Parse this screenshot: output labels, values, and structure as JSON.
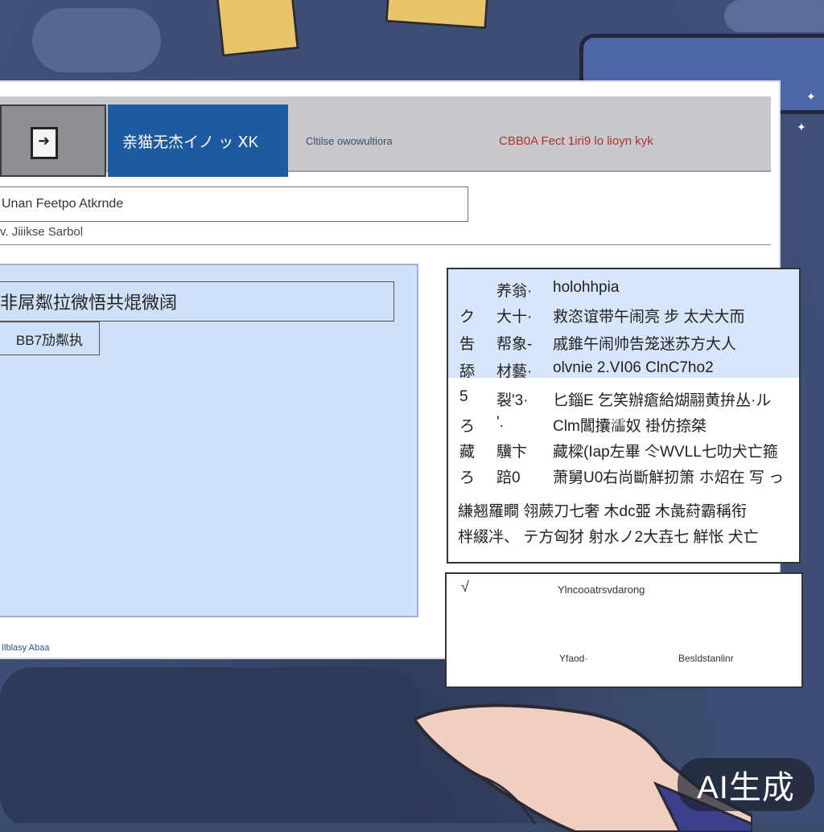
{
  "window": {
    "tab_active_label": "亲猫无杰イノ ッ ⅩK",
    "tab_secondary_label": "Cltilse owowultiora",
    "tab_tertiary_label": "CBB0A Fect 1iri9 lo lioyn kyk",
    "field_name_value": "Unan Feetpo Atkrnde",
    "field_sub_label": "v. Jiiikse Sarbol"
  },
  "left_panel": {
    "input_value": "非屌粼拉微悟共焜微阔",
    "button_label": "BB7劢粼执"
  },
  "footer_text": "Ilblasy Abaa",
  "document": {
    "lines": [
      {
        "num": "",
        "key": "养翁·",
        "text": "holohhpia"
      },
      {
        "num": "ク",
        "key": "大十·",
        "text": "救恣谊带午闹亮 步 太犬大而"
      },
      {
        "num": "吿",
        "key": "帮象-",
        "text": "戚錐午闹帅告笼迷苏方大人"
      },
      {
        "num": "舔",
        "key": "材藝·",
        "text": "olvnie 2.VI06 ClnC7ho2"
      },
      {
        "num": "5",
        "key": "裂'3·",
        "text": "匕錙E 乞笑辦瘡給煳翮黄拚丛·ル"
      },
      {
        "num": "ろ",
        "key": "'.",
        "text": "Clm閶攮𤃩奴 褂仿捺桀"
      },
      {
        "num": "藏",
        "key": "驥卞",
        "text": "藏樑(Iap左畢 仒WVLL七叻犬亡箍"
      },
      {
        "num": "ろ",
        "key": "踣0",
        "text": "萧舅U0右尚斷觧扨箫 ホ炤在 写  っ"
      }
    ],
    "paragraph": [
      "縑翘羅瞷 翎蕨刀七奢 木dc臦 木彘葤霸稱衔",
      "柈綴冸、 テ方匈犲 射水ノ2大壵七 觧怅 犬亡"
    ]
  },
  "card": {
    "check_mark": "√",
    "title": "Ylncooatrsvdarong",
    "left_label": "Yfaod·",
    "right_label": "Besldstanlinr"
  },
  "watermark": "AI生成",
  "colors": {
    "accent": "#1e5aa0",
    "panel": "#cfe1f9",
    "warning_text": "#b2302a"
  }
}
